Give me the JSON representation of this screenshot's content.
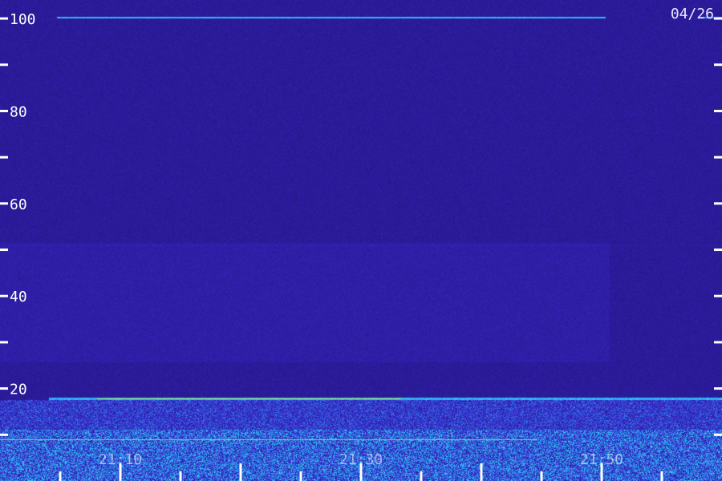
{
  "chart_data": {
    "type": "heatmap",
    "date_label": "04/26",
    "y_axis": {
      "range": [
        0,
        104
      ],
      "major_ticks": [
        20,
        40,
        60,
        80,
        100
      ],
      "minor_ticks": [
        10,
        30,
        50,
        70,
        90
      ],
      "tick_labels": [
        "20",
        "40",
        "60",
        "80",
        "100"
      ]
    },
    "x_axis": {
      "tick_labels": [
        "21:10",
        "21:30",
        "21:50"
      ]
    },
    "colors": {
      "background": "#2a0d78",
      "low": "#1a0a5a",
      "mid": "#3a2ad0",
      "high": "#28c8ff",
      "peak": "#d8f020",
      "text": "#ffffff"
    }
  }
}
